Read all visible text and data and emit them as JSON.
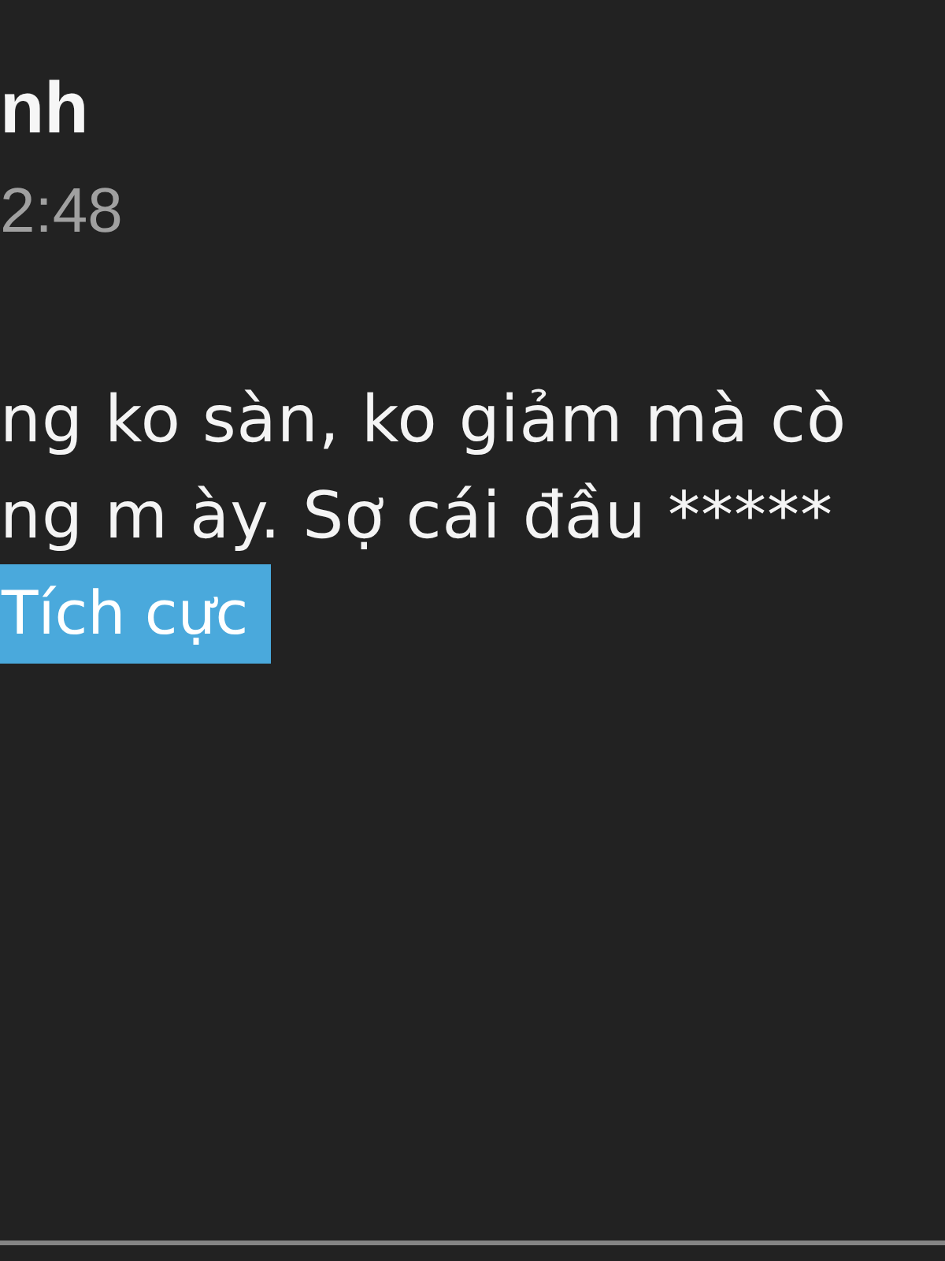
{
  "message": {
    "sender": "nh",
    "time": "2:48",
    "lines": [
      "ng ko sàn, ko giảm mà cò",
      "ng m ày. Sợ cái đầu *****"
    ],
    "highlight": {
      "text": "Tích cực",
      "color": "#4aa9dc"
    }
  }
}
